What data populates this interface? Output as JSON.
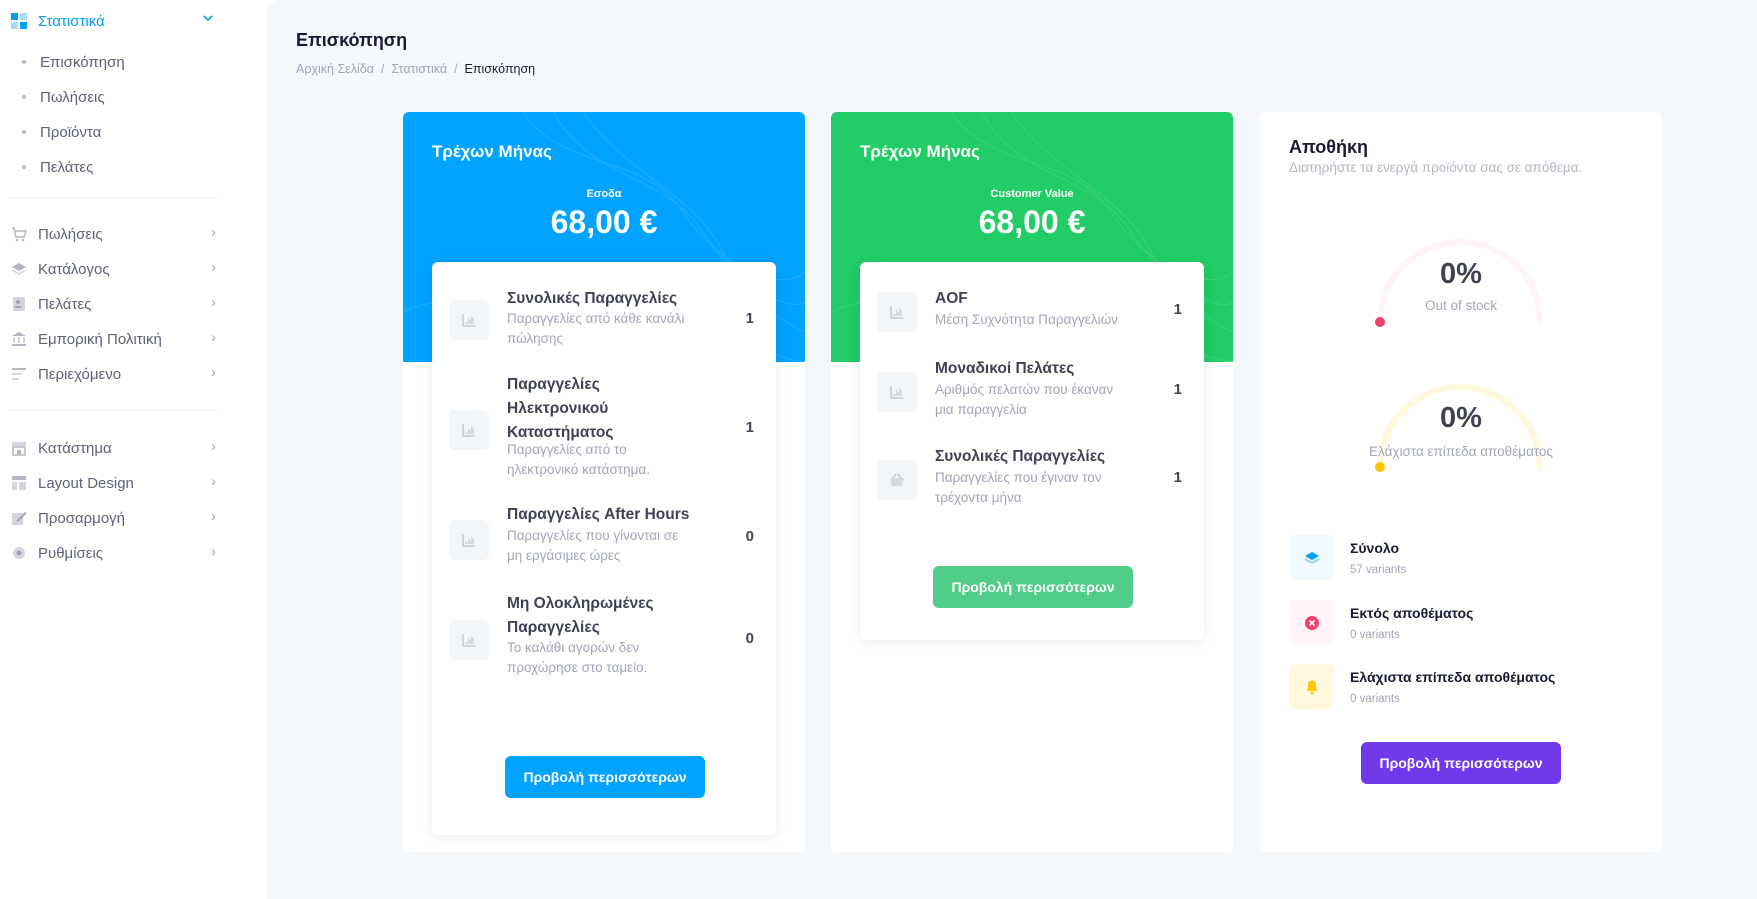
{
  "sidebar": {
    "active_section": {
      "label": "Στατιστικά",
      "icon": "dashboard-icon"
    },
    "sub_items": [
      {
        "label": "Επισκόπηση"
      },
      {
        "label": "Πωλήσεις"
      },
      {
        "label": "Προϊόντα"
      },
      {
        "label": "Πελάτες"
      }
    ],
    "group1": [
      {
        "label": "Πωλήσεις",
        "icon": "cart-icon"
      },
      {
        "label": "Κατάλογος",
        "icon": "layers-icon"
      },
      {
        "label": "Πελάτες",
        "icon": "contacts-icon"
      },
      {
        "label": "Εμπορική Πολιτική",
        "icon": "bank-icon"
      },
      {
        "label": "Περιεχόμενο",
        "icon": "text-lines-icon"
      }
    ],
    "group2": [
      {
        "label": "Κατάστημα",
        "icon": "store-icon"
      },
      {
        "label": "Layout Design",
        "icon": "layout-icon"
      },
      {
        "label": "Προσαρμογή",
        "icon": "edit-icon"
      },
      {
        "label": "Ρυθμίσεις",
        "icon": "gear-icon"
      }
    ]
  },
  "header": {
    "title": "Επισκόπηση",
    "breadcrumb": [
      "Αρχική Σελίδα",
      "Στατιστικά",
      "Επισκόπηση"
    ]
  },
  "income_card": {
    "title": "Τρέχων Μήνας",
    "subtitle": "Εσοδα",
    "amount": "68,00 €",
    "color": "#00a3ff",
    "rows": [
      {
        "title": "Συνολικές Παραγγελίες",
        "desc": "Παραγγελίες από κάθε κανάλι πώλησης",
        "value": "1"
      },
      {
        "title": "Παραγγελίες Ηλεκτρονικού Καταστήματος",
        "desc": "Παραγγελίες από το ηλεκτρονικό κατάστημα.",
        "value": "1"
      },
      {
        "title": "Παραγγελίες After Hours",
        "desc": "Παραγγελίες που γίνονται σε μη εργάσιμες ώρες",
        "value": "0"
      },
      {
        "title": "Μη Ολοκληρωμένες Παραγγελίες",
        "desc": "Το καλάθι αγορών δεν προχώρησε στο ταμείο.",
        "value": "0"
      }
    ],
    "button": "Προβολή περισσότερων"
  },
  "customer_card": {
    "title": "Τρέχων Μήνας",
    "subtitle": "Customer Value",
    "amount": "68,00 €",
    "color": "#22cc66",
    "rows": [
      {
        "title": "AOF",
        "desc": "Μέση Συχνότητα Παραγγελιών",
        "value": "1"
      },
      {
        "title": "Μοναδικοί Πελάτες",
        "desc": "Αριθμός πελατών που έκαναν μια παραγγελία",
        "value": "1"
      },
      {
        "title": "Συνολικές Παραγγελίες",
        "desc": "Παραγγελίες που έγιναν τον τρέχοντα μήνα",
        "value": "1"
      }
    ],
    "button": "Προβολή περισσότερων"
  },
  "storage_card": {
    "title": "Αποθήκη",
    "subtitle": "Διατηρήστε τα ενεργά προϊόντα σας σε απόθεμα.",
    "gauges": [
      {
        "value": "0%",
        "label": "Out of stock",
        "fraction": 0,
        "color": "#f1416c",
        "track": "#fff5f8"
      },
      {
        "value": "0%",
        "label": "Ελάχιστα επίπεδα αποθέματος",
        "fraction": 0,
        "color": "#ffc700",
        "track": "#fff8dd"
      }
    ],
    "items": [
      {
        "title": "Σύνολο",
        "sub": "57 variants",
        "icon": "layers-icon"
      },
      {
        "title": "Εκτός αποθέματος",
        "sub": "0 variants",
        "icon": "close-circle-icon"
      },
      {
        "title": "Ελάχιστα επίπεδα αποθέματος",
        "sub": "0 variants",
        "icon": "bell-icon"
      }
    ],
    "button": "Προβολή περισσότερων"
  }
}
